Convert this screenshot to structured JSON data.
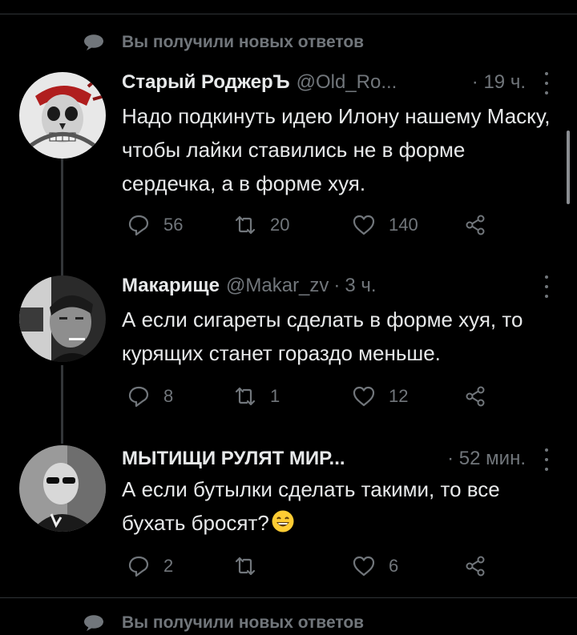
{
  "notice": {
    "text": "Вы получили новых ответов"
  },
  "tweets": [
    {
      "name": "Старый РоджерЪ",
      "handle": "@Old_Ro...",
      "time": "· 19 ч.",
      "text": "Надо подкинуть идею Илону нашему Маску, чтобы лайки ставились не в форме сердечка, а в форме хуя.",
      "replies": "56",
      "retweets": "20",
      "likes": "140",
      "avatar_icon": "pirate-skull-avatar"
    },
    {
      "name": "Макарище",
      "handle": "@Makar_zv",
      "time": "3 ч.",
      "text": "А если сигареты сделать в форме хуя, то курящих станет гораздо меньше.",
      "replies": "8",
      "retweets": "1",
      "likes": "12",
      "avatar_icon": "man-smoking-avatar"
    },
    {
      "name": "МЫТИЩИ РУЛЯТ МИР...",
      "handle": "",
      "time": "· 52 мин.",
      "text": "А если бутылки сделать такими, то все бухать бросят?",
      "emoji": "grinning-face-emoji",
      "replies": "2",
      "retweets": "",
      "likes": "6",
      "avatar_icon": "man-sunglasses-avatar"
    }
  ],
  "icons": {
    "reply": "reply-icon",
    "retweet": "retweet-icon",
    "like": "heart-icon",
    "share": "share-icon",
    "more": "more-icon",
    "notice": "speech-bubble-icon"
  },
  "colors": {
    "background": "#000000",
    "secondary_text": "#71767b",
    "primary_text": "#e7e9ea"
  }
}
